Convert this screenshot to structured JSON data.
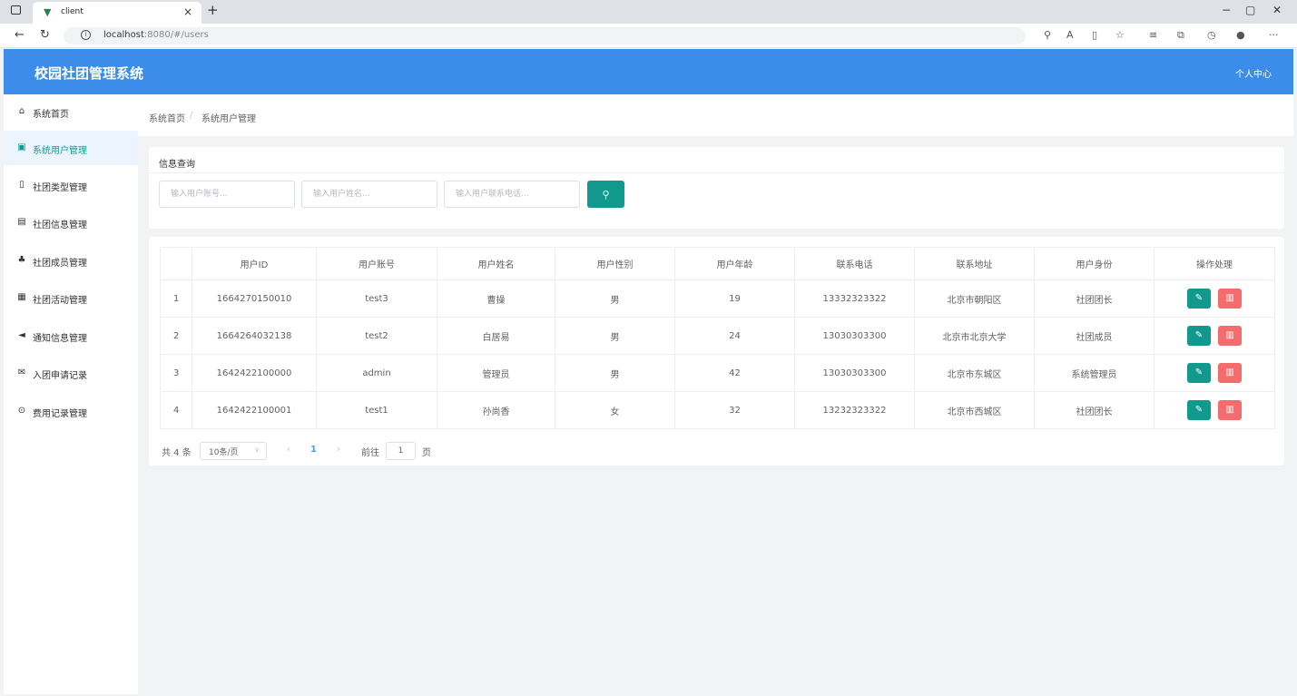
{
  "browser": {
    "tab_title": "client",
    "favicon": "vue-icon",
    "url_host": "localhost",
    "url_path": ":8080/#/users"
  },
  "app": {
    "brand": "校园社团管理系统",
    "user_center": "个人中心",
    "accent_color": "#3c8dea",
    "primary_color": "#11998e",
    "danger_color": "#f56c6c"
  },
  "sidebar": {
    "items": [
      {
        "label": "系统首页",
        "icon": "home-icon"
      },
      {
        "label": "系统用户管理",
        "icon": "user-icon",
        "active": true
      },
      {
        "label": "社团类型管理",
        "icon": "tablet-icon"
      },
      {
        "label": "社团信息管理",
        "icon": "document-icon"
      },
      {
        "label": "社团成员管理",
        "icon": "members-icon"
      },
      {
        "label": "社团活动管理",
        "icon": "calculator-icon"
      },
      {
        "label": "通知信息管理",
        "icon": "megaphone-icon"
      },
      {
        "label": "入团申请记录",
        "icon": "mail-icon"
      },
      {
        "label": "费用记录管理",
        "icon": "clock-icon"
      }
    ]
  },
  "breadcrumb": {
    "home": "系统首页",
    "separator": "/",
    "current": "系统用户管理"
  },
  "search": {
    "title": "信息查询",
    "account_placeholder": "输入用户账号...",
    "name_placeholder": "输入用户姓名...",
    "phone_placeholder": "输入用户联系电话...",
    "button_icon": "search-icon"
  },
  "table": {
    "columns": [
      "",
      "用户ID",
      "用户账号",
      "用户姓名",
      "用户性别",
      "用户年龄",
      "联系电话",
      "联系地址",
      "用户身份",
      "操作处理"
    ],
    "rows": [
      [
        "1",
        "1664270150010",
        "test3",
        "曹操",
        "男",
        "19",
        "13332323322",
        "北京市朝阳区",
        "社团团长"
      ],
      [
        "2",
        "1664264032138",
        "test2",
        "白居易",
        "男",
        "24",
        "13030303300",
        "北京市北京大学",
        "社团成员"
      ],
      [
        "3",
        "1642422100000",
        "admin",
        "管理员",
        "男",
        "42",
        "13030303300",
        "北京市东城区",
        "系统管理员"
      ],
      [
        "4",
        "1642422100001",
        "test1",
        "孙尚香",
        "女",
        "32",
        "13232323322",
        "北京市西城区",
        "社团团长"
      ]
    ]
  },
  "pagination": {
    "total": "共 4 条",
    "page_size": "10条/页",
    "current_page": "1",
    "goto_label": "前往",
    "goto_value": "1",
    "page_unit": "页"
  }
}
